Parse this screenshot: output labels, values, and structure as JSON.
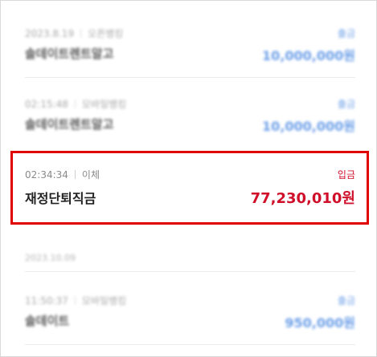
{
  "transactions": [
    {
      "time": "2023.8.19",
      "channel": "오픈뱅킹",
      "type": "출금",
      "name": "솔데이트렌트알고",
      "amount": "10,000,000원"
    },
    {
      "time": "02:15:48",
      "channel": "모바일뱅킹",
      "type": "출금",
      "name": "솔데이트렌트알고",
      "amount": "10,000,000원"
    },
    {
      "time": "02:34:34",
      "channel": "이체",
      "type": "입금",
      "name": "재정단퇴직금",
      "amount": "77,230,010원"
    },
    {
      "time": "11:50:37",
      "channel": "모바일뱅킹",
      "type": "출금",
      "name": "솔데이트",
      "amount": "950,000원"
    }
  ],
  "date_header": "2023.10.09",
  "colors": {
    "withdraw": "#3b7fe0",
    "deposit": "#d0102a",
    "highlight": "#e00000"
  }
}
